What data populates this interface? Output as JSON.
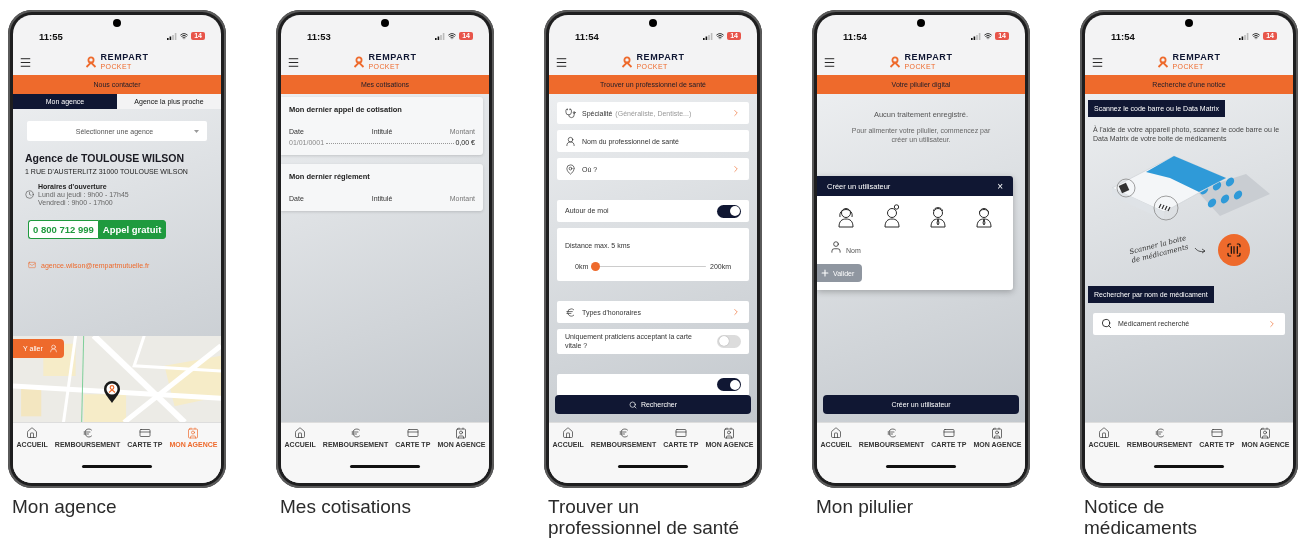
{
  "phones": [
    {
      "kind": "agence",
      "caption": "Mon agence",
      "time": "11:55",
      "battery": "14",
      "brand": "REMPART",
      "brand_sub": "POCKET",
      "title": "Nous contacter",
      "tabs": [
        {
          "label": "Mon agence",
          "selected": true
        },
        {
          "label": "Agence la plus proche",
          "selected": false
        }
      ],
      "select": {
        "placeholder": "Sélectionner une agence"
      },
      "agency": {
        "name": "Agence de TOULOUSE WILSON",
        "address": "1 RUE D'AUSTERLITZ 31000 TOULOUSE WILSON",
        "hours_title": "Horaires d'ouverture",
        "hours": [
          "Lundi au jeudi : 9h00 - 17h45",
          "Vendredi : 9h00 - 17h00"
        ],
        "phone": "0 800 712 999",
        "phone_label": "Appel gratuit",
        "email": "agence.wilson@rempartmutuelle.fr"
      },
      "map": {
        "kind": "picture",
        "go_button": "Y aller"
      },
      "nav": [
        {
          "label": "ACCUEIL",
          "selected": false
        },
        {
          "label": "REMBOURSEMENT",
          "selected": false
        },
        {
          "label": "CARTE TP",
          "selected": false
        },
        {
          "label": "MON AGENCE",
          "selected": true
        }
      ]
    },
    {
      "kind": "cotisations",
      "caption": "Mes cotisations",
      "time": "11:53",
      "battery": "14",
      "brand": "REMPART",
      "brand_sub": "POCKET",
      "title": "Mes cotisations",
      "cards": [
        {
          "title": "Mon dernier appel de cotisation",
          "columns": [
            "Date",
            "Intitulé",
            "Montant"
          ],
          "rows": [
            {
              "date": "01/01/0001",
              "amount": "0,00 €"
            }
          ]
        },
        {
          "title": "Mon dernier réglement",
          "columns": [
            "Date",
            "Intitulé",
            "Montant"
          ]
        }
      ],
      "nav": [
        {
          "label": "ACCUEIL",
          "selected": false
        },
        {
          "label": "REMBOURSEMENT",
          "selected": false
        },
        {
          "label": "CARTE TP",
          "selected": false
        },
        {
          "label": "MON AGENCE",
          "selected": false
        }
      ]
    },
    {
      "kind": "recherche",
      "caption": "Trouver un\nprofessionnel de santé",
      "time": "11:54",
      "battery": "14",
      "brand": "REMPART",
      "brand_sub": "POCKET",
      "title": "Trouver un professionnel de santé",
      "groups": [
        [
          {
            "kind": "select",
            "label": "Spécialité",
            "hint": "(Généraliste, Dentiste...)",
            "arrow": true
          },
          {
            "kind": "select",
            "label": "Nom du professionnel de santé",
            "arrow": false
          },
          {
            "kind": "select",
            "label": "Où ?",
            "arrow": true
          }
        ],
        [
          {
            "kind": "toggle",
            "label": "Autour de moi",
            "on": true
          },
          {
            "kind": "slider",
            "label": "Distance max. 5 kms",
            "min": "0km",
            "max": "200km",
            "level": 0.025
          }
        ],
        [
          {
            "kind": "select",
            "label": "Types d'honoraires",
            "arrow": true
          },
          {
            "kind": "toggle",
            "label": "Uniquement praticiens acceptant la carte vitale ?",
            "on": false
          }
        ],
        [
          {
            "kind": "toggle",
            "on": true
          }
        ]
      ],
      "button": "Rechercher",
      "nav": [
        {
          "label": "ACCUEIL",
          "selected": false
        },
        {
          "label": "REMBOURSEMENT",
          "selected": false
        },
        {
          "label": "CARTE TP",
          "selected": false
        },
        {
          "label": "MON AGENCE",
          "selected": false
        }
      ]
    },
    {
      "kind": "pilulier",
      "caption": "Mon pilulier",
      "time": "11:54",
      "battery": "14",
      "brand": "REMPART",
      "brand_sub": "POCKET",
      "title": "Votre pilulier digital",
      "empty": {
        "headline": "Aucun traitement enregistré.",
        "text": "Pour alimenter votre pilulier, commencez par créer un utilisateur."
      },
      "dialog": {
        "title": "Créer un utilisateur",
        "close": "×",
        "name_placeholder": "Nom",
        "submit": "Valider"
      },
      "button": "Créer un utilisateur",
      "nav": [
        {
          "label": "ACCUEIL",
          "selected": false
        },
        {
          "label": "REMBOURSEMENT",
          "selected": false
        },
        {
          "label": "CARTE TP",
          "selected": false
        },
        {
          "label": "MON AGENCE",
          "selected": false
        }
      ]
    },
    {
      "kind": "notice",
      "caption": "Notice de\nmédicaments",
      "time": "11:54",
      "battery": "14",
      "brand": "REMPART",
      "brand_sub": "POCKET",
      "title": "Recherche d'une notice",
      "scan_label": "Scannez le code barre ou le Data Matrix",
      "scan_text": "À l'aide de votre appareil photo, scannez le code barre ou le Data Matrix de votre boite de médicaments",
      "scan_note": "Scanner la boite de médicaments",
      "search_label": "Rechercher par nom de médicament",
      "search": {
        "placeholder": "Médicament recherché"
      },
      "nav": [
        {
          "label": "ACCUEIL",
          "selected": false
        },
        {
          "label": "REMBOURSEMENT",
          "selected": false
        },
        {
          "label": "CARTE TP",
          "selected": false
        },
        {
          "label": "MON AGENCE",
          "selected": false
        }
      ]
    }
  ]
}
